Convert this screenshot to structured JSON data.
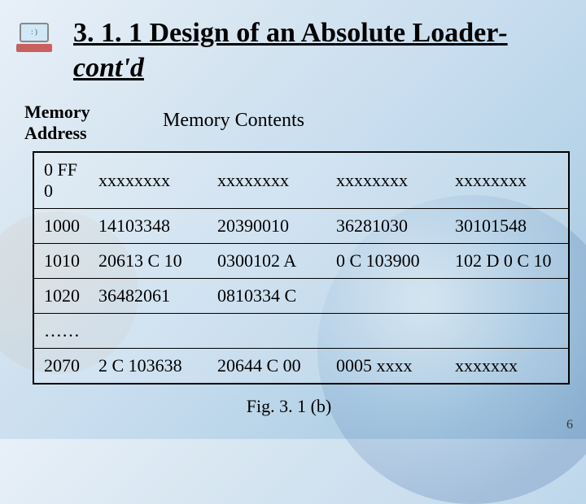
{
  "icon_face": ": )",
  "title_main": "3. 1. 1 Design of an Absolute Loader",
  "title_suffix": "-cont'd",
  "header_addr_l1": "Memory",
  "header_addr_l2": "Address",
  "header_contents": "Memory Contents",
  "rows": [
    {
      "addr": "0 FF 0",
      "c1": "xxxxxxxx",
      "c2": "xxxxxxxx",
      "c3": "xxxxxxxx",
      "c4": "xxxxxxxx"
    },
    {
      "addr": "1000",
      "c1": "14103348",
      "c2": "20390010",
      "c3": "36281030",
      "c4": "30101548"
    },
    {
      "addr": "1010",
      "c1": "20613 C 10",
      "c2": "0300102 A",
      "c3": "0 C 103900",
      "c4": "102 D 0 C 10"
    },
    {
      "addr": "1020",
      "c1": "36482061",
      "c2": "0810334 C",
      "c3": "",
      "c4": ""
    },
    {
      "addr": "……",
      "c1": "",
      "c2": "",
      "c3": "",
      "c4": ""
    },
    {
      "addr": "2070",
      "c1": "2 C 103638",
      "c2": "20644 C 00",
      "c3": "0005 xxxx",
      "c4": "xxxxxxx"
    }
  ],
  "figcap": "Fig. 3. 1 (b)",
  "pagenum": "6"
}
